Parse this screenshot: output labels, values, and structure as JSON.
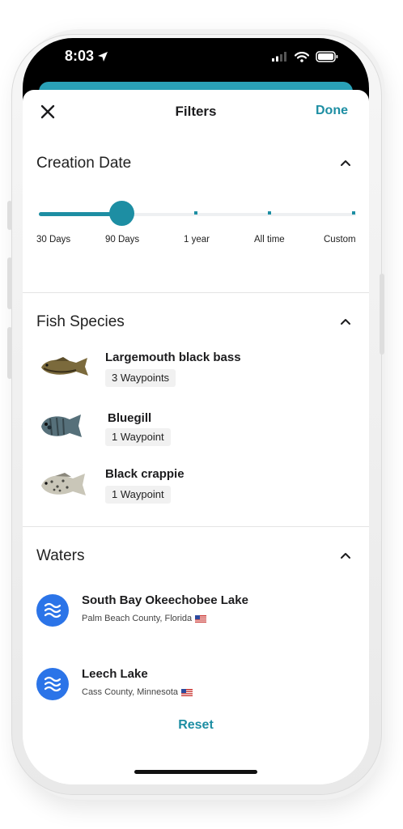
{
  "status": {
    "time": "8:03"
  },
  "header": {
    "title": "Filters",
    "done_label": "Done"
  },
  "creation_date": {
    "title": "Creation Date",
    "options": [
      "30 Days",
      "90 Days",
      "1 year",
      "All time",
      "Custom"
    ],
    "selected": "90 Days"
  },
  "fish_species": {
    "title": "Fish Species",
    "items": [
      {
        "name": "Largemouth black bass",
        "waypoints": "3 Waypoints",
        "icon": "largemouth-bass-image"
      },
      {
        "name": "Bluegill",
        "waypoints": "1 Waypoint",
        "icon": "bluegill-image"
      },
      {
        "name": "Black crappie",
        "waypoints": "1 Waypoint",
        "icon": "black-crappie-image"
      }
    ]
  },
  "waters": {
    "title": "Waters",
    "items": [
      {
        "name": "South Bay Okeechobee Lake",
        "location": "Palm Beach County, Florida",
        "flag": "us-flag"
      },
      {
        "name": "Leech Lake",
        "location": "Cass County, Minnesota",
        "flag": "us-flag"
      }
    ]
  },
  "footer": {
    "reset_label": "Reset"
  },
  "colors": {
    "accent": "#1d8ea3",
    "water_icon": "#2b74e8"
  }
}
